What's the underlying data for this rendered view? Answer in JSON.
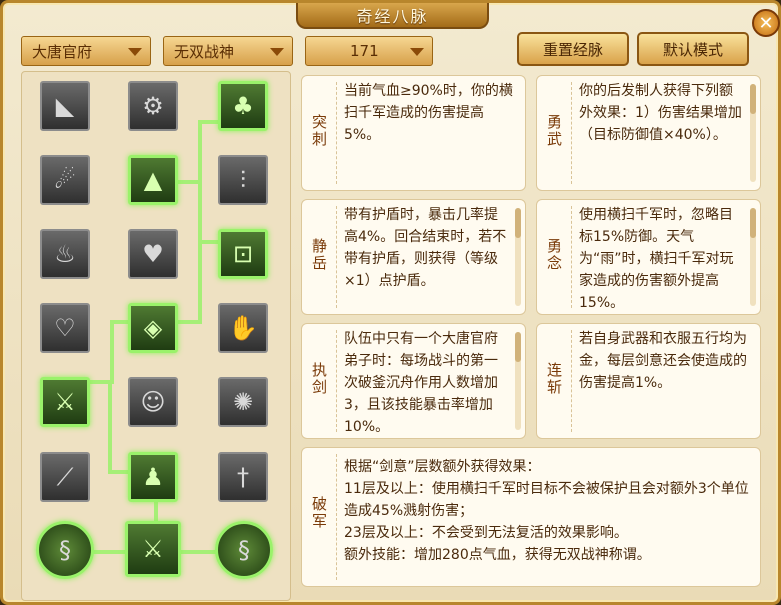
{
  "window": {
    "title": "奇经八脉",
    "close_glyph": "✕"
  },
  "toolbar": {
    "school": "大唐官府",
    "talent": "无双战神",
    "level": "171",
    "reset_label": "重置经脉",
    "default_label": "默认模式"
  },
  "skill_icons": [
    "horn-icon",
    "network-icon",
    "figure-icon",
    "whirl-icon",
    "rock-icon",
    "spikes-icon",
    "flame-icon",
    "heart-hands-icon",
    "gate-icon",
    "armor-icon",
    "diamond-emblem-icon",
    "hand-leaf-icon",
    "sword-arm-icon",
    "monk-icon",
    "burst-icon",
    "broken-blade-icon",
    "warrior-icon",
    "blade-pillar-icon",
    "swirl-icon",
    "twin-blades-icon",
    "swirl-icon"
  ],
  "cards": {
    "tuci": {
      "name": "突刺",
      "desc": "当前气血≥90%时，你的横扫千军造成的伤害提高5%。"
    },
    "yongwu": {
      "name": "勇武",
      "desc": "你的后发制人获得下列额外效果：1）伤害结果增加（目标防御值×40%）。"
    },
    "jingyue": {
      "name": "静岳",
      "desc": "带有护盾时，暴击几率提高4%。回合结束时，若不带有护盾，则获得（等级×1）点护盾。"
    },
    "yongnian": {
      "name": "勇念",
      "desc": "使用横扫千军时，忽略目标15%防御。天气为“雨”时，横扫千军对玩家造成的伤害额外提高15%。"
    },
    "zhijian": {
      "name": "执剑",
      "desc": "队伍中只有一个大唐官府弟子时：每场战斗的第一次破釜沉舟作用人数增加3，且该技能暴击率增加10%。"
    },
    "lianzhan": {
      "name": "连斩",
      "desc": "若自身武器和衣服五行均为金，每层剑意还会使造成的伤害提高1%。"
    },
    "pojun": {
      "name": "破军",
      "lines": [
        "根据“剑意”层数额外获得效果：",
        "11层及以上：使用横扫千军时目标不会被保护且会对额外3个单位造成45%溅射伤害；",
        "23层及以上：不会受到无法复活的效果影响。",
        "额外技能：增加280点气血，获得无双战神称谓。"
      ]
    }
  }
}
